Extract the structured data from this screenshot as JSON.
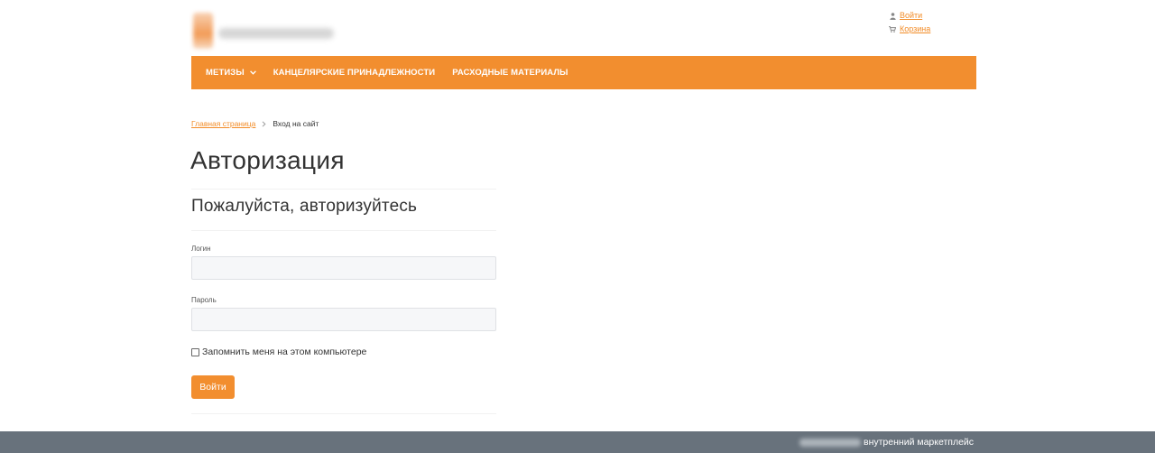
{
  "header": {
    "user_links": {
      "login_label": "Войти",
      "cart_label": "Корзина"
    }
  },
  "nav": {
    "items": [
      {
        "label": "МЕТИЗЫ",
        "has_dropdown": true
      },
      {
        "label": "КАНЦЕЛЯРСКИЕ ПРИНАДЛЕЖНОСТИ"
      },
      {
        "label": "РАСХОДНЫЕ МАТЕРИАЛЫ"
      }
    ]
  },
  "breadcrumb": {
    "home": "Главная страница",
    "current": "Вход на сайт"
  },
  "page": {
    "title": "Авторизация",
    "subtitle": "Пожалуйста, авторизуйтесь"
  },
  "form": {
    "login_label": "Логин",
    "login_value": "",
    "password_label": "Пароль",
    "password_value": "",
    "remember_label": "Запомнить меня на этом компьютере",
    "remember_checked": false,
    "submit_label": "Войти"
  },
  "footer": {
    "tagline": "внутренний маркетплейс"
  },
  "colors": {
    "accent": "#f28e2f",
    "footer_bg": "#68727c"
  }
}
